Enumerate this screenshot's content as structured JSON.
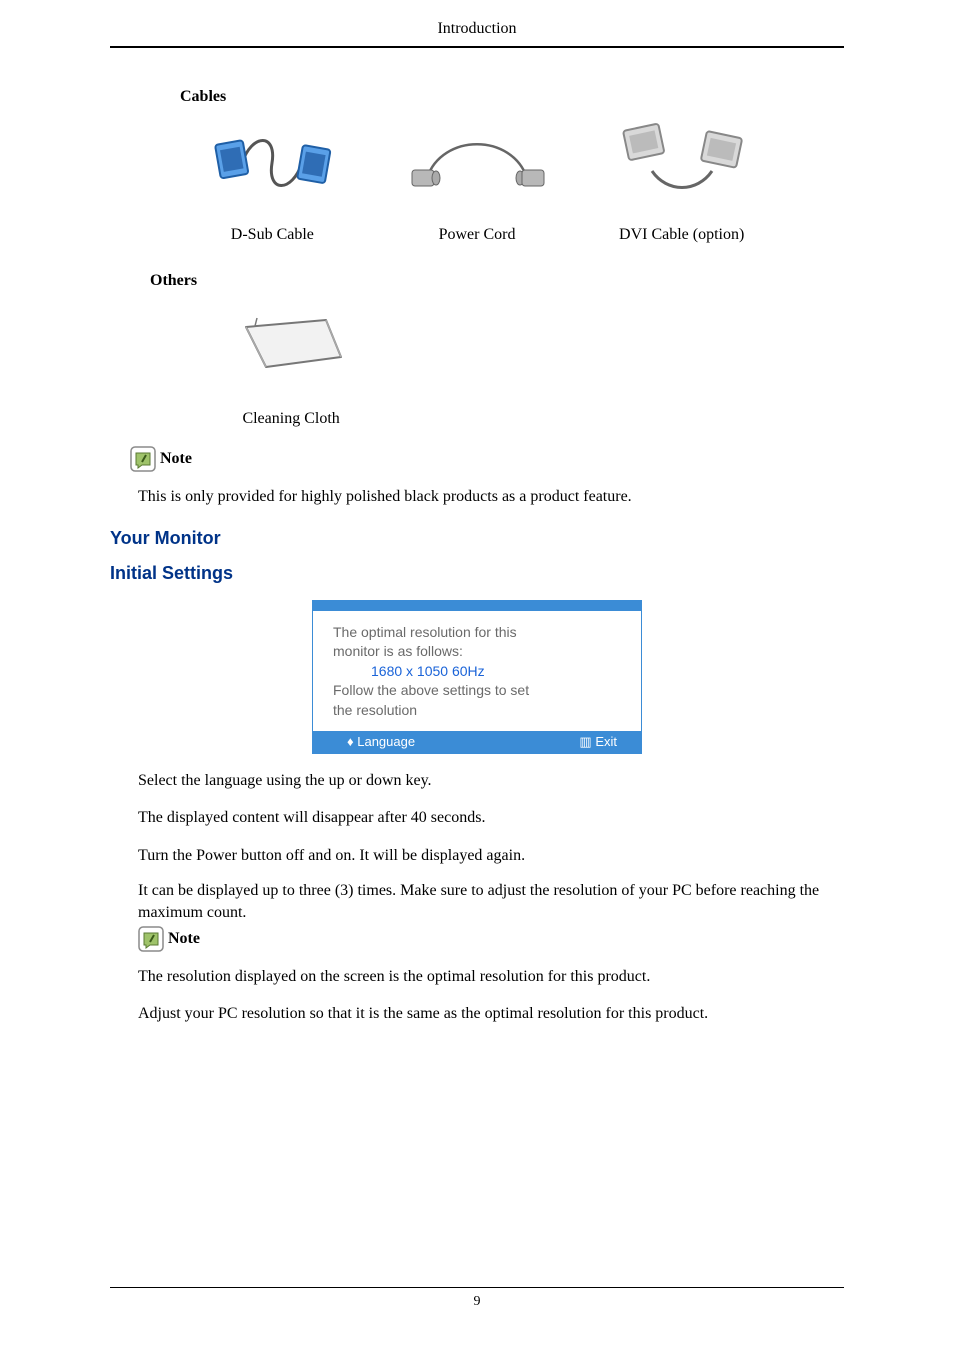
{
  "header": {
    "title": "Introduction"
  },
  "sections": {
    "cables_label": "Cables",
    "cables": [
      {
        "label": "D-Sub Cable"
      },
      {
        "label": "Power Cord"
      },
      {
        "label": "DVI Cable (option)"
      }
    ],
    "others_label": "Others",
    "others": [
      {
        "label": "Cleaning Cloth"
      }
    ],
    "note_label": "Note",
    "note_body": "This is only provided for highly polished black products as a product feature."
  },
  "your_monitor": "Your Monitor",
  "initial_settings": "Initial Settings",
  "osd": {
    "line1": "The optimal resolution for this",
    "line2": "monitor is as follows:",
    "resolution": "1680 x 1050 60Hz",
    "line3": "Follow the above settings to set",
    "line4": "the resolution",
    "control_left": "♦ Language",
    "control_right": "▥ Exit"
  },
  "paragraphs": {
    "p1": "Select the language using the up or down key.",
    "p2": "The displayed content will disappear after 40 seconds.",
    "p3": "Turn the Power button off and on. It will be displayed again.",
    "p4": "It can be displayed up to three (3) times. Make sure to adjust the resolution of your PC before reaching the maximum count.",
    "note2_label": "Note",
    "p5": "The resolution displayed on the screen is the optimal resolution for this product.",
    "p6": "Adjust your PC resolution so that it is the same as the optimal resolution for this product."
  },
  "footer": {
    "page_number": "9"
  }
}
